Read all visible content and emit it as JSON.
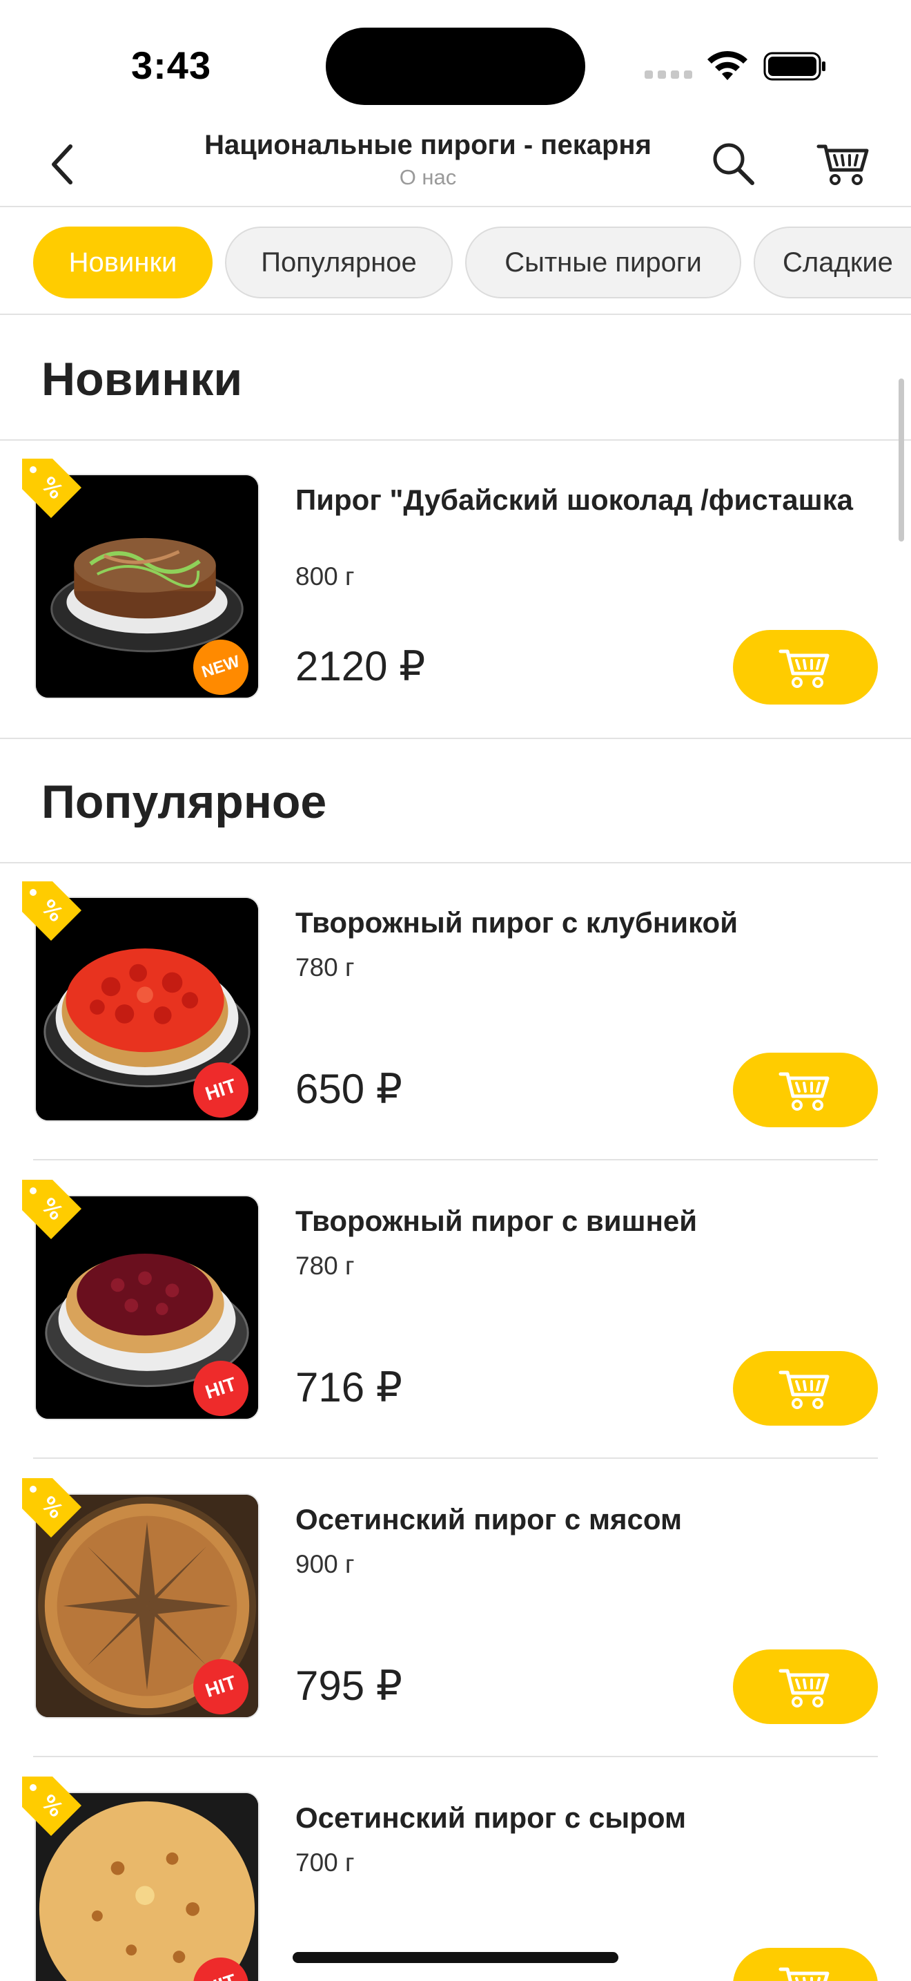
{
  "status_bar": {
    "time": "3:43"
  },
  "nav": {
    "title": "Национальные пироги - пекарня",
    "subtitle": "О нас"
  },
  "tabs": [
    {
      "label": "Новинки",
      "active": true
    },
    {
      "label": "Популярное",
      "active": false
    },
    {
      "label": "Сытные пироги",
      "active": false
    },
    {
      "label": "Сладкие",
      "active": false
    }
  ],
  "sections": [
    {
      "title": "Новинки",
      "products": [
        {
          "name": "Пирог \"Дубайский шоколад /фисташка",
          "weight": "800 г",
          "price": "2120 ₽",
          "badge": "NEW"
        }
      ]
    },
    {
      "title": "Популярное",
      "products": [
        {
          "name": "Творожный пирог с клубникой",
          "weight": "780 г",
          "price": "650 ₽",
          "badge": "HIT"
        },
        {
          "name": "Творожный пирог с вишней",
          "weight": "780 г",
          "price": "716 ₽",
          "badge": "HIT"
        },
        {
          "name": "Осетинский пирог с мясом",
          "weight": "900 г",
          "price": "795 ₽",
          "badge": "HIT"
        },
        {
          "name": "Осетинский пирог с сыром",
          "weight": "700 г",
          "price": "",
          "badge": "HIT"
        }
      ]
    }
  ],
  "colors": {
    "accent": "#ffcc00",
    "new_badge": "#ff8a00",
    "hit_badge": "#ee2b2b"
  },
  "icons": [
    "back-icon",
    "search-icon",
    "cart-icon",
    "sale-tag-icon",
    "add-to-cart-icon"
  ]
}
